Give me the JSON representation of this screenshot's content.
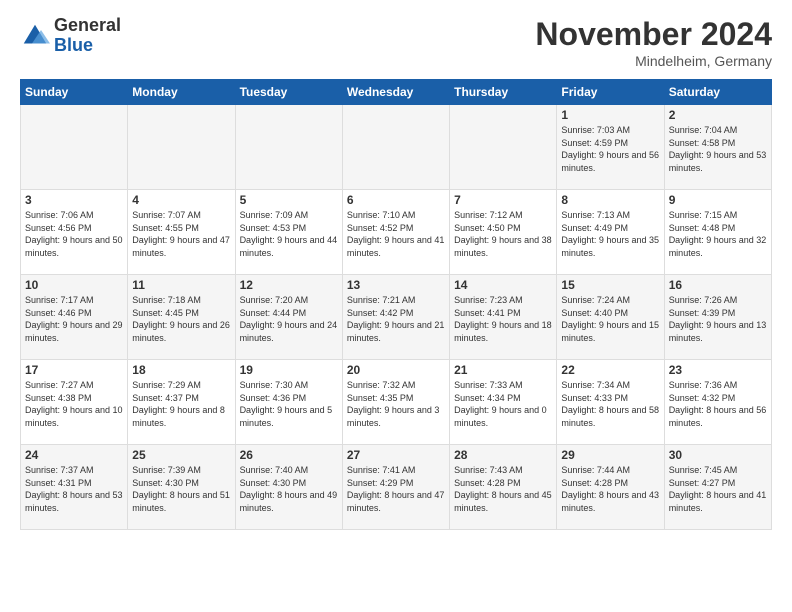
{
  "logo": {
    "general": "General",
    "blue": "Blue"
  },
  "title": "November 2024",
  "location": "Mindelheim, Germany",
  "days_of_week": [
    "Sunday",
    "Monday",
    "Tuesday",
    "Wednesday",
    "Thursday",
    "Friday",
    "Saturday"
  ],
  "weeks": [
    [
      {
        "day": "",
        "info": ""
      },
      {
        "day": "",
        "info": ""
      },
      {
        "day": "",
        "info": ""
      },
      {
        "day": "",
        "info": ""
      },
      {
        "day": "",
        "info": ""
      },
      {
        "day": "1",
        "info": "Sunrise: 7:03 AM\nSunset: 4:59 PM\nDaylight: 9 hours and 56 minutes."
      },
      {
        "day": "2",
        "info": "Sunrise: 7:04 AM\nSunset: 4:58 PM\nDaylight: 9 hours and 53 minutes."
      }
    ],
    [
      {
        "day": "3",
        "info": "Sunrise: 7:06 AM\nSunset: 4:56 PM\nDaylight: 9 hours and 50 minutes."
      },
      {
        "day": "4",
        "info": "Sunrise: 7:07 AM\nSunset: 4:55 PM\nDaylight: 9 hours and 47 minutes."
      },
      {
        "day": "5",
        "info": "Sunrise: 7:09 AM\nSunset: 4:53 PM\nDaylight: 9 hours and 44 minutes."
      },
      {
        "day": "6",
        "info": "Sunrise: 7:10 AM\nSunset: 4:52 PM\nDaylight: 9 hours and 41 minutes."
      },
      {
        "day": "7",
        "info": "Sunrise: 7:12 AM\nSunset: 4:50 PM\nDaylight: 9 hours and 38 minutes."
      },
      {
        "day": "8",
        "info": "Sunrise: 7:13 AM\nSunset: 4:49 PM\nDaylight: 9 hours and 35 minutes."
      },
      {
        "day": "9",
        "info": "Sunrise: 7:15 AM\nSunset: 4:48 PM\nDaylight: 9 hours and 32 minutes."
      }
    ],
    [
      {
        "day": "10",
        "info": "Sunrise: 7:17 AM\nSunset: 4:46 PM\nDaylight: 9 hours and 29 minutes."
      },
      {
        "day": "11",
        "info": "Sunrise: 7:18 AM\nSunset: 4:45 PM\nDaylight: 9 hours and 26 minutes."
      },
      {
        "day": "12",
        "info": "Sunrise: 7:20 AM\nSunset: 4:44 PM\nDaylight: 9 hours and 24 minutes."
      },
      {
        "day": "13",
        "info": "Sunrise: 7:21 AM\nSunset: 4:42 PM\nDaylight: 9 hours and 21 minutes."
      },
      {
        "day": "14",
        "info": "Sunrise: 7:23 AM\nSunset: 4:41 PM\nDaylight: 9 hours and 18 minutes."
      },
      {
        "day": "15",
        "info": "Sunrise: 7:24 AM\nSunset: 4:40 PM\nDaylight: 9 hours and 15 minutes."
      },
      {
        "day": "16",
        "info": "Sunrise: 7:26 AM\nSunset: 4:39 PM\nDaylight: 9 hours and 13 minutes."
      }
    ],
    [
      {
        "day": "17",
        "info": "Sunrise: 7:27 AM\nSunset: 4:38 PM\nDaylight: 9 hours and 10 minutes."
      },
      {
        "day": "18",
        "info": "Sunrise: 7:29 AM\nSunset: 4:37 PM\nDaylight: 9 hours and 8 minutes."
      },
      {
        "day": "19",
        "info": "Sunrise: 7:30 AM\nSunset: 4:36 PM\nDaylight: 9 hours and 5 minutes."
      },
      {
        "day": "20",
        "info": "Sunrise: 7:32 AM\nSunset: 4:35 PM\nDaylight: 9 hours and 3 minutes."
      },
      {
        "day": "21",
        "info": "Sunrise: 7:33 AM\nSunset: 4:34 PM\nDaylight: 9 hours and 0 minutes."
      },
      {
        "day": "22",
        "info": "Sunrise: 7:34 AM\nSunset: 4:33 PM\nDaylight: 8 hours and 58 minutes."
      },
      {
        "day": "23",
        "info": "Sunrise: 7:36 AM\nSunset: 4:32 PM\nDaylight: 8 hours and 56 minutes."
      }
    ],
    [
      {
        "day": "24",
        "info": "Sunrise: 7:37 AM\nSunset: 4:31 PM\nDaylight: 8 hours and 53 minutes."
      },
      {
        "day": "25",
        "info": "Sunrise: 7:39 AM\nSunset: 4:30 PM\nDaylight: 8 hours and 51 minutes."
      },
      {
        "day": "26",
        "info": "Sunrise: 7:40 AM\nSunset: 4:30 PM\nDaylight: 8 hours and 49 minutes."
      },
      {
        "day": "27",
        "info": "Sunrise: 7:41 AM\nSunset: 4:29 PM\nDaylight: 8 hours and 47 minutes."
      },
      {
        "day": "28",
        "info": "Sunrise: 7:43 AM\nSunset: 4:28 PM\nDaylight: 8 hours and 45 minutes."
      },
      {
        "day": "29",
        "info": "Sunrise: 7:44 AM\nSunset: 4:28 PM\nDaylight: 8 hours and 43 minutes."
      },
      {
        "day": "30",
        "info": "Sunrise: 7:45 AM\nSunset: 4:27 PM\nDaylight: 8 hours and 41 minutes."
      }
    ]
  ]
}
